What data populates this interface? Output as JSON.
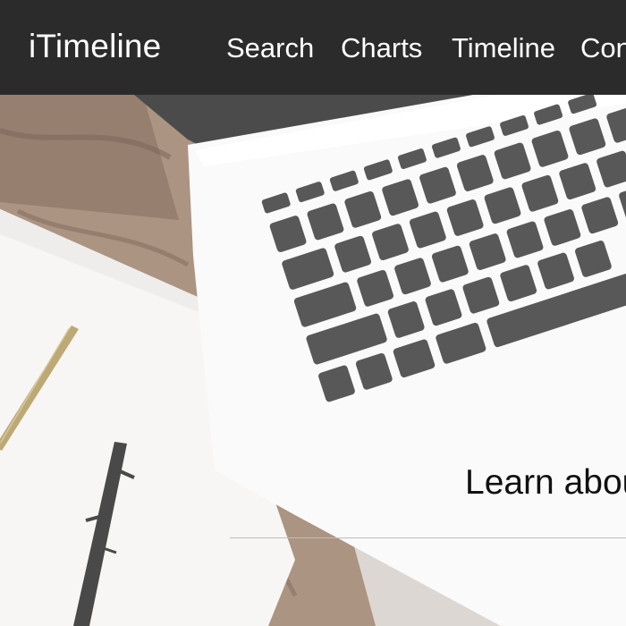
{
  "navbar": {
    "brand": "iTimeline",
    "links": [
      {
        "label": "Search"
      },
      {
        "label": "Charts"
      },
      {
        "label": "Timeline"
      },
      {
        "label": "Con"
      }
    ]
  },
  "hero": {
    "heading": "Learn abou",
    "background_icon": "laptop-on-desk-photo"
  },
  "colors": {
    "navbar_bg": "#2b2b2c",
    "nav_text": "#ffffff",
    "hero_text": "#111111"
  }
}
